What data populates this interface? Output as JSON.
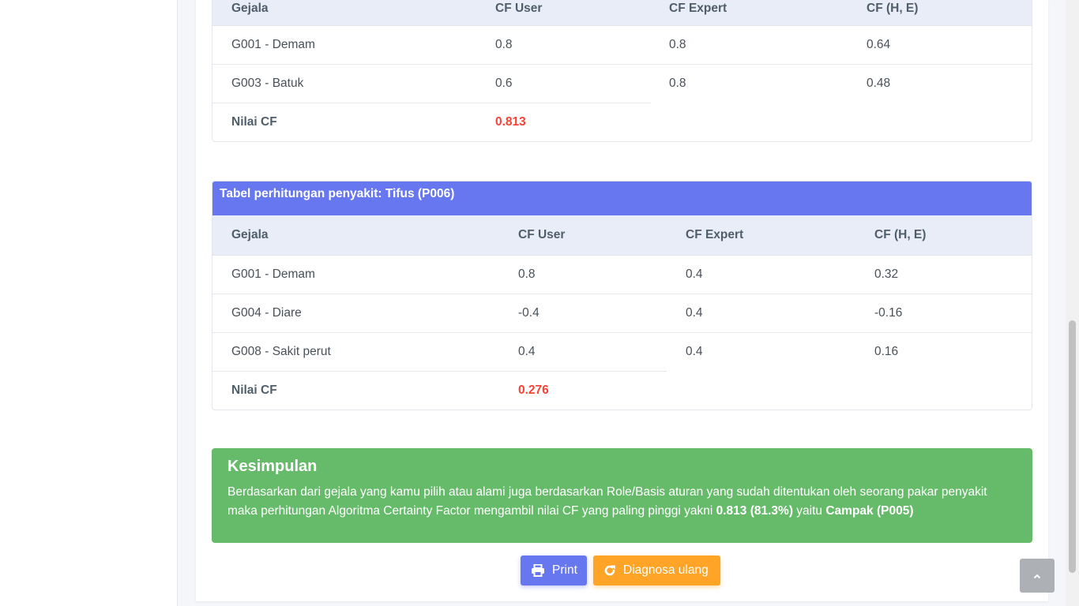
{
  "table_top": {
    "headers": [
      "Gejala",
      "CF User",
      "CF Expert",
      "CF (H, E)"
    ],
    "rows": [
      {
        "gejala": "G001 - Demam",
        "cf_user": "0.8",
        "cf_expert": "0.8",
        "cf_he": "0.64"
      },
      {
        "gejala": "G003 - Batuk",
        "cf_user": "0.6",
        "cf_expert": "0.8",
        "cf_he": "0.48"
      }
    ],
    "nilai_label": "Nilai CF",
    "nilai_value": "0.813"
  },
  "table_tifus": {
    "title": "Tabel perhitungan penyakit: Tifus (P006)",
    "headers": [
      "Gejala",
      "CF User",
      "CF Expert",
      "CF (H, E)"
    ],
    "rows": [
      {
        "gejala": "G001 - Demam",
        "cf_user": "0.8",
        "cf_expert": "0.4",
        "cf_he": "0.32"
      },
      {
        "gejala": "G004 - Diare",
        "cf_user": "-0.4",
        "cf_expert": "0.4",
        "cf_he": "-0.16"
      },
      {
        "gejala": "G008 - Sakit perut",
        "cf_user": "0.4",
        "cf_expert": "0.4",
        "cf_he": "0.16"
      }
    ],
    "nilai_label": "Nilai CF",
    "nilai_value": "0.276"
  },
  "conclusion": {
    "title": "Kesimpulan",
    "text": "Berdasarkan dari gejala yang kamu pilih atau alami juga berdasarkan Role/Basis aturan yang sudah ditentukan oleh seorang pakar penyakit maka perhitungan Algoritma Certainty Factor mengambil nilai CF yang paling pinggi yakni",
    "value": "0.813 (81.3%)",
    "connector": "yaitu",
    "disease": "Campak (P005)"
  },
  "buttons": {
    "print": "Print",
    "rediagnose": "Diagnosa ulang"
  },
  "icons": {
    "print": "printer-icon",
    "rediagnose": "redo-icon",
    "to_top": "chevron-up-icon"
  },
  "colors": {
    "primary": "#6777ef",
    "warning": "#ffa426",
    "success": "#66bb6a",
    "danger": "#f44336",
    "table_header": "#e9edf7"
  }
}
